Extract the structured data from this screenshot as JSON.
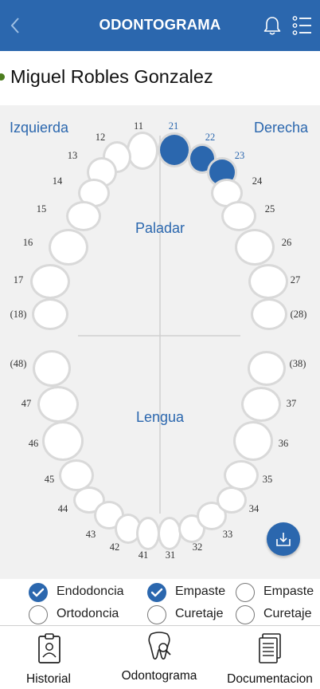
{
  "header": {
    "title": "ODONTOGRAMA",
    "icons": {
      "back": "chevron-left-icon",
      "notifications": "bell-icon",
      "menu": "list-menu-icon"
    }
  },
  "patient": {
    "name": "Miguel Robles Gonzalez"
  },
  "chart": {
    "left_label": "Izquierda",
    "right_label": "Derecha",
    "upper_label": "Paladar",
    "lower_label": "Lengua",
    "colors": {
      "selected": "#2b67ae",
      "tooth": "#ffffff",
      "tooth_border": "#d9d9d9"
    },
    "upper_teeth": [
      {
        "number": "11",
        "selected": false
      },
      {
        "number": "12",
        "selected": false
      },
      {
        "number": "13",
        "selected": false
      },
      {
        "number": "14",
        "selected": false
      },
      {
        "number": "15",
        "selected": false
      },
      {
        "number": "16",
        "selected": false
      },
      {
        "number": "17",
        "selected": false
      },
      {
        "number": "(18)",
        "selected": false
      },
      {
        "number": "21",
        "selected": true
      },
      {
        "number": "22",
        "selected": true
      },
      {
        "number": "23",
        "selected": true
      },
      {
        "number": "24",
        "selected": false
      },
      {
        "number": "25",
        "selected": false
      },
      {
        "number": "26",
        "selected": false
      },
      {
        "number": "27",
        "selected": false
      },
      {
        "number": "(28)",
        "selected": false
      }
    ],
    "lower_teeth": [
      {
        "number": "(48)",
        "selected": false
      },
      {
        "number": "47",
        "selected": false
      },
      {
        "number": "46",
        "selected": false
      },
      {
        "number": "45",
        "selected": false
      },
      {
        "number": "44",
        "selected": false
      },
      {
        "number": "43",
        "selected": false
      },
      {
        "number": "42",
        "selected": false
      },
      {
        "number": "41",
        "selected": false
      },
      {
        "number": "31",
        "selected": false
      },
      {
        "number": "32",
        "selected": false
      },
      {
        "number": "33",
        "selected": false
      },
      {
        "number": "34",
        "selected": false
      },
      {
        "number": "35",
        "selected": false
      },
      {
        "number": "36",
        "selected": false
      },
      {
        "number": "37",
        "selected": false
      },
      {
        "number": "(38)",
        "selected": false
      }
    ],
    "fab_icon": "download-tray-icon"
  },
  "options": [
    {
      "label": "Endodoncia",
      "checked": true
    },
    {
      "label": "Empaste",
      "checked": true
    },
    {
      "label": "Empaste",
      "checked": false
    },
    {
      "label": "Ortodoncia",
      "checked": false
    },
    {
      "label": "Curetaje",
      "checked": false
    },
    {
      "label": "Curetaje",
      "checked": false
    }
  ],
  "bottom_nav": [
    {
      "label": "Historial",
      "icon": "clipboard-user-icon"
    },
    {
      "label": "Odontograma",
      "icon": "tooth-icon"
    },
    {
      "label": "Documentacion",
      "icon": "documents-icon"
    }
  ]
}
